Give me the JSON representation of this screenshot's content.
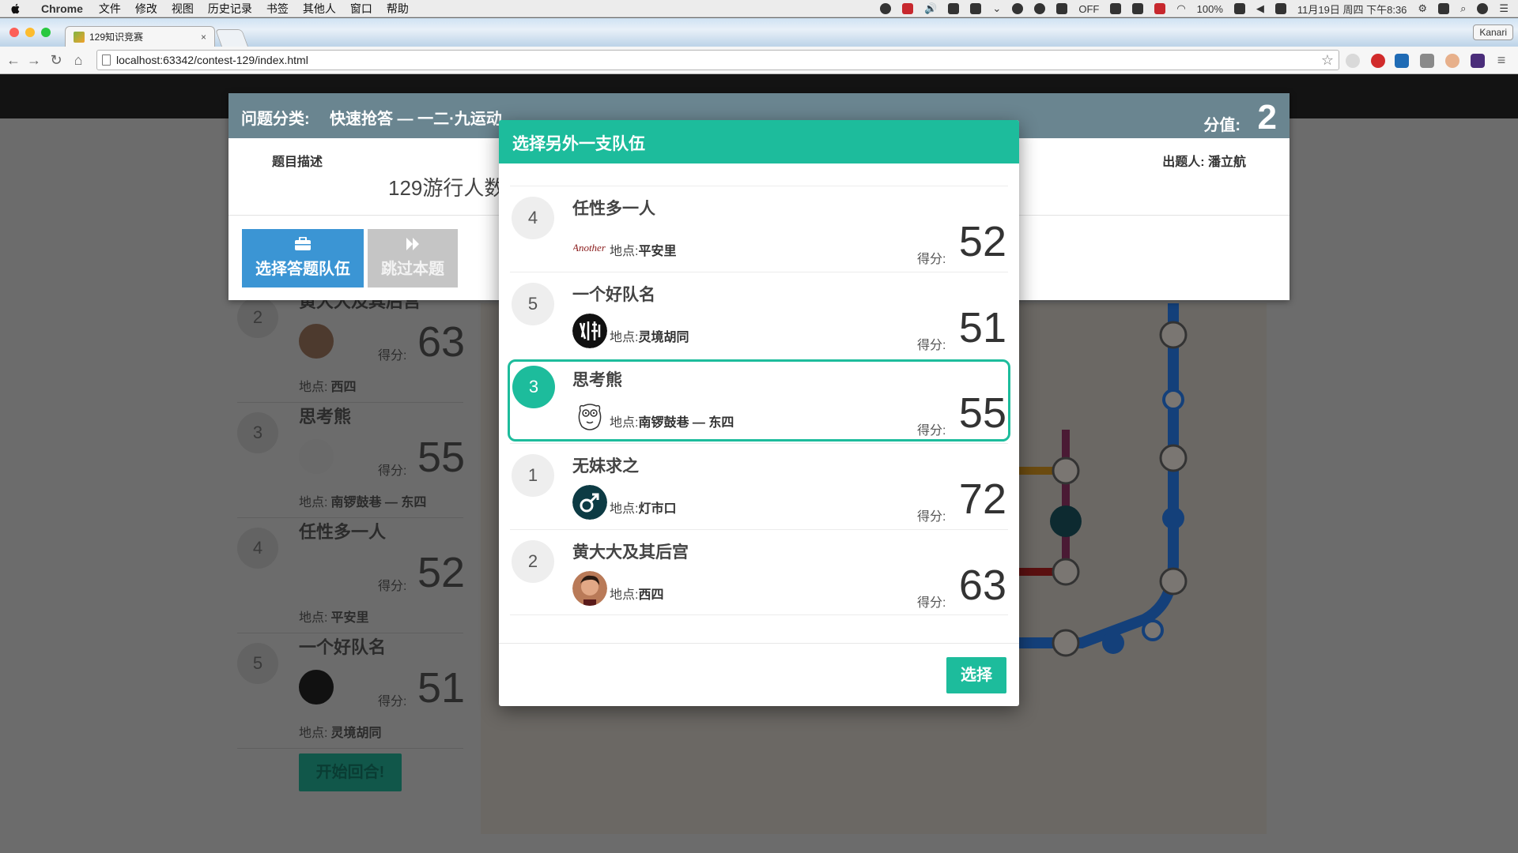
{
  "menubar": {
    "app": "Chrome",
    "items": [
      "文件",
      "修改",
      "视图",
      "历史记录",
      "书签",
      "其他人",
      "窗口",
      "帮助"
    ],
    "status": {
      "off": "OFF",
      "battery": "100%",
      "datetime": "11月19日 周四 下午8:36"
    }
  },
  "browser": {
    "tab_title": "129知识竞赛",
    "tab_close": "×",
    "profile": "Kanari",
    "url": "localhost:63342/contest-129/index.html"
  },
  "background": {
    "teams": [
      {
        "rank": "2",
        "name": "黄大大及其后宫",
        "score_label": "得分:",
        "score": "63",
        "loc_label": "地点:",
        "location": "西四"
      },
      {
        "rank": "3",
        "name": "思考熊",
        "score_label": "得分:",
        "score": "55",
        "loc_label": "地点:",
        "location": "南锣鼓巷 — 东四"
      },
      {
        "rank": "4",
        "name": "任性多一人",
        "score_label": "得分:",
        "score": "52",
        "loc_label": "地点:",
        "location": "平安里"
      },
      {
        "rank": "5",
        "name": "一个好队名",
        "score_label": "得分:",
        "score": "51",
        "loc_label": "地点:",
        "location": "灵境胡同"
      }
    ],
    "start_button": "开始回合!"
  },
  "question": {
    "category_label": "问题分类:",
    "category": "快速抢答 — 一二·九运动",
    "value_label": "分值:",
    "value": "2",
    "desc_label": "题目描述",
    "text": "129游行人数",
    "author_label": "出题人:",
    "author": "潘立航",
    "choose_team_button": "选择答题队伍",
    "skip_button": "跳过本题"
  },
  "modal": {
    "title": "选择另外一支队伍",
    "teams": [
      {
        "rank": "4",
        "name": "任性多一人",
        "loc_label": "地点:",
        "location": "平安里",
        "score_label": "得分:",
        "score": "52",
        "avatar": "another-logo",
        "selected": false
      },
      {
        "rank": "5",
        "name": "一个好队名",
        "loc_label": "地点:",
        "location": "灵境胡同",
        "score_label": "得分:",
        "score": "51",
        "avatar": "calligraphy-logo",
        "selected": false
      },
      {
        "rank": "3",
        "name": "思考熊",
        "loc_label": "地点:",
        "location": "南锣鼓巷 — 东四",
        "score_label": "得分:",
        "score": "55",
        "avatar": "bear-face",
        "selected": true
      },
      {
        "rank": "1",
        "name": "无妹求之",
        "loc_label": "地点:",
        "location": "灯市口",
        "score_label": "得分:",
        "score": "72",
        "avatar": "male-symbol",
        "selected": false
      },
      {
        "rank": "2",
        "name": "黄大大及其后宫",
        "loc_label": "地点:",
        "location": "西四",
        "score_label": "得分:",
        "score": "63",
        "avatar": "photo-portrait",
        "selected": false
      }
    ],
    "select_button": "选择"
  },
  "colors": {
    "accent": "#1dbc9c",
    "header_bg": "#6a8590",
    "primary_button": "#3b95d4"
  }
}
